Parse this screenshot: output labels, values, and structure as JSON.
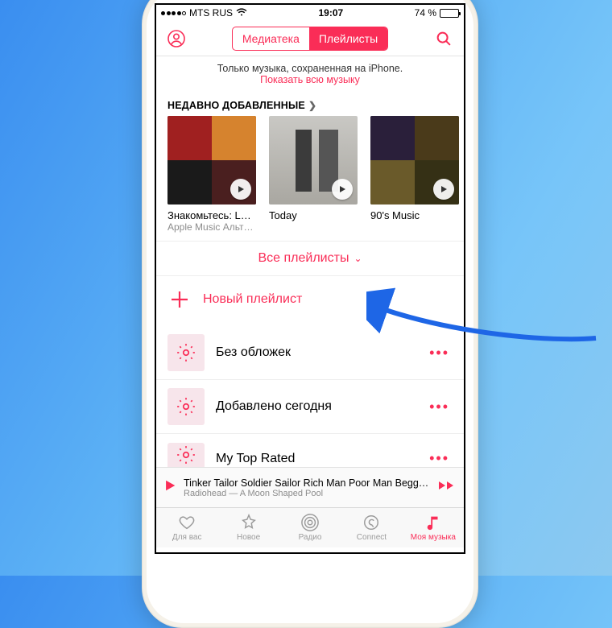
{
  "statusbar": {
    "carrier": "MTS RUS",
    "time": "19:07",
    "battery_pct": "74 %"
  },
  "header": {
    "seg_library": "Медиатека",
    "seg_playlists": "Плейлисты"
  },
  "banner": {
    "line1": "Только музыка, сохраненная на iPhone.",
    "link": "Показать всю музыку"
  },
  "recent": {
    "heading": "НЕДАВНО ДОБАВЛЕННЫЕ",
    "items": [
      {
        "title": "Знакомьтесь: Lush",
        "subtitle": "Apple Music Альт…"
      },
      {
        "title": "Today",
        "subtitle": ""
      },
      {
        "title": "90's Music",
        "subtitle": ""
      }
    ]
  },
  "filter": {
    "label": "Все плейлисты"
  },
  "new_playlist": {
    "label": "Новый плейлист"
  },
  "playlists": [
    {
      "label": "Без обложек"
    },
    {
      "label": "Добавлено сегодня"
    },
    {
      "label": "My Top Rated"
    }
  ],
  "now_playing": {
    "title": "Tinker Tailor Soldier Sailor Rich Man Poor Man Begg…",
    "subtitle": "Radiohead — A Moon Shaped Pool"
  },
  "tabs": {
    "for_you": "Для вас",
    "new": "Новое",
    "radio": "Радио",
    "connect": "Connect",
    "my_music": "Моя музыка"
  },
  "colors": {
    "accent": "#fa2d57"
  }
}
